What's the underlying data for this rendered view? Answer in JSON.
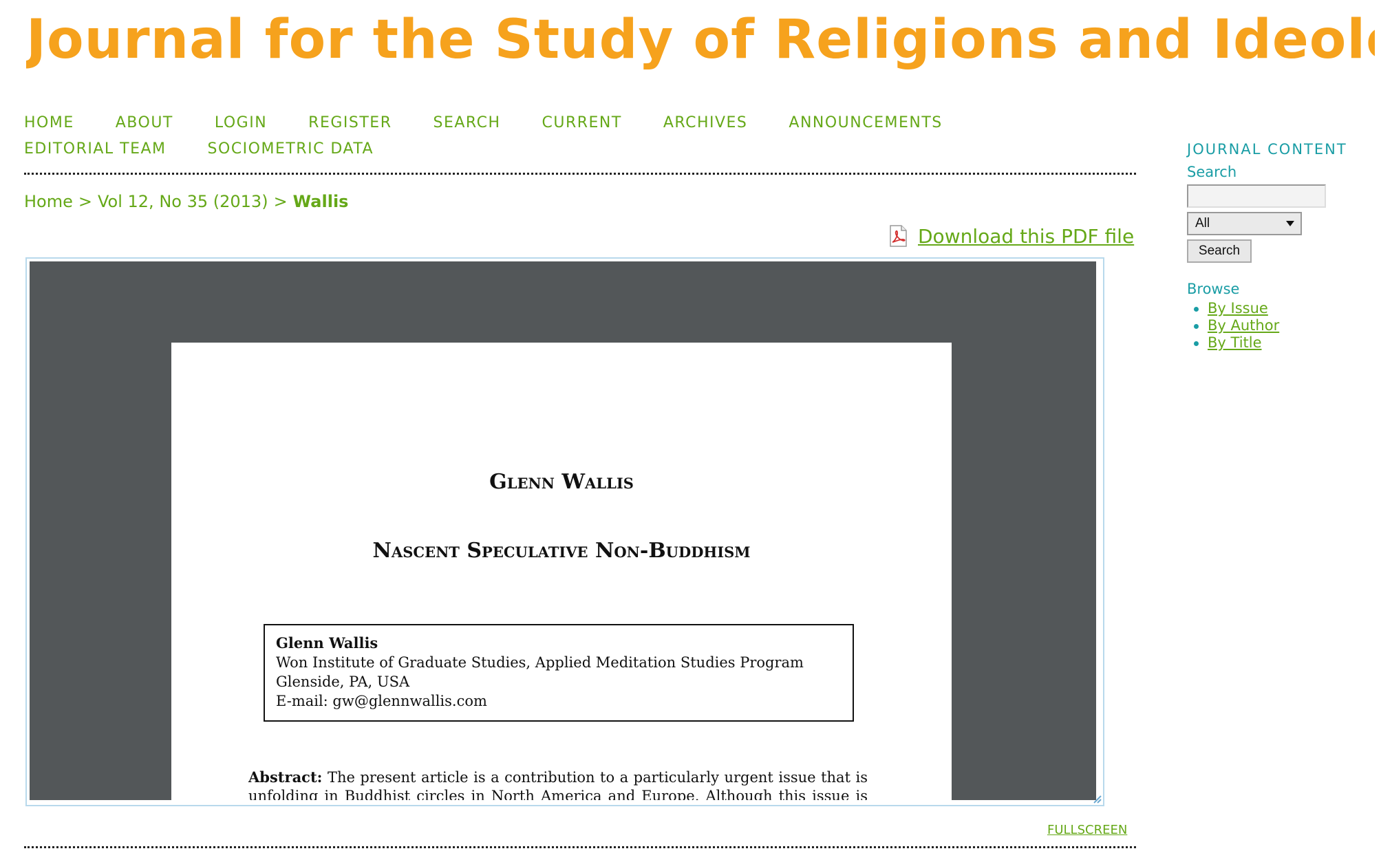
{
  "masthead": {
    "title": "Journal for the Study of Religions and Ideologies"
  },
  "nav": {
    "items": [
      {
        "label": "HOME"
      },
      {
        "label": "ABOUT"
      },
      {
        "label": "LOGIN"
      },
      {
        "label": "REGISTER"
      },
      {
        "label": "SEARCH"
      },
      {
        "label": "CURRENT"
      },
      {
        "label": "ARCHIVES"
      },
      {
        "label": "ANNOUNCEMENTS"
      },
      {
        "label": "EDITORIAL TEAM"
      },
      {
        "label": "SOCIOMETRIC DATA"
      }
    ]
  },
  "breadcrumb": {
    "home": "Home",
    "issue": "Vol 12, No 35 (2013)",
    "current": "Wallis",
    "separator": ">"
  },
  "download": {
    "label": "Download this PDF file",
    "icon": "pdf-icon"
  },
  "pdf": {
    "author_heading": "Glenn Wallis",
    "title": "Nascent Speculative Non-Buddhism",
    "affiliation": {
      "name": "Glenn Wallis",
      "institution": "Won Institute of Graduate Studies, Applied Meditation Studies Program",
      "location": "Glenside, PA, USA",
      "email": "E-mail: gw@glennwallis.com"
    },
    "abstract_label": "Abstract:",
    "abstract_text": "The present article is a contribution to a particularly urgent issue that is unfolding in Buddhist circles in North America and Europe. Although this issue is framed in"
  },
  "fullscreen": {
    "label": "FULLSCREEN"
  },
  "sidebar": {
    "title": "JOURNAL CONTENT",
    "search_label": "Search",
    "search_value": "",
    "select_value": "All",
    "search_button": "Search",
    "browse_label": "Browse",
    "browse_items": [
      {
        "label": "By Issue"
      },
      {
        "label": "By Author"
      },
      {
        "label": "By Title"
      }
    ]
  },
  "colors": {
    "masthead": "#f6a21d",
    "link_green": "#65a818",
    "sidebar_teal": "#1a9da5",
    "viewer_bg": "#535759"
  }
}
